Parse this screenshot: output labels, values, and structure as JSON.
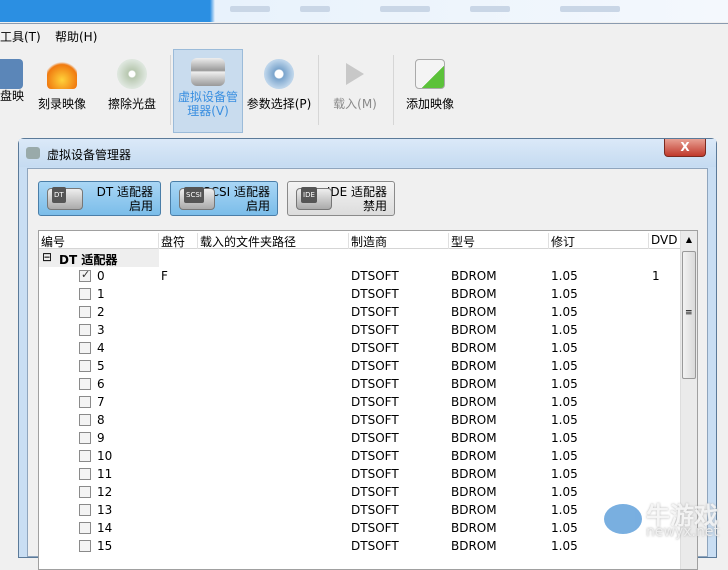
{
  "menu": {
    "tools": "工具(T)",
    "help": "帮助(H)"
  },
  "toolbar": {
    "partial": "盘映",
    "burn": "刻录映像",
    "erase": "擦除光盘",
    "vdm": "虚拟设备管理器(V)",
    "params": "参数选择(P)",
    "mount": "载入(M)",
    "add": "添加映像"
  },
  "dialog": {
    "title": "虚拟设备管理器",
    "close": "X",
    "adapters": [
      {
        "tag": "DT",
        "name": "DT 适配器",
        "state": "启用"
      },
      {
        "tag": "SCSI",
        "name": "SCSI 适配器",
        "state": "启用"
      },
      {
        "tag": "IDE",
        "name": "IDE 适配器",
        "state": "禁用"
      }
    ],
    "columns": [
      "编号",
      "盘符",
      "载入的文件夹路径",
      "制造商",
      "型号",
      "修订",
      "DVD ["
    ],
    "group": "DT 适配器",
    "group_toggle": "⊟",
    "rows": [
      {
        "id": "0",
        "drive": "F",
        "path": "",
        "vendor": "DTSOFT",
        "model": "BDROM",
        "rev": "1.05",
        "dvd": "1",
        "checked": true
      },
      {
        "id": "1",
        "drive": "",
        "path": "",
        "vendor": "DTSOFT",
        "model": "BDROM",
        "rev": "1.05",
        "dvd": "",
        "checked": false
      },
      {
        "id": "2",
        "drive": "",
        "path": "",
        "vendor": "DTSOFT",
        "model": "BDROM",
        "rev": "1.05",
        "dvd": "",
        "checked": false
      },
      {
        "id": "3",
        "drive": "",
        "path": "",
        "vendor": "DTSOFT",
        "model": "BDROM",
        "rev": "1.05",
        "dvd": "",
        "checked": false
      },
      {
        "id": "4",
        "drive": "",
        "path": "",
        "vendor": "DTSOFT",
        "model": "BDROM",
        "rev": "1.05",
        "dvd": "",
        "checked": false
      },
      {
        "id": "5",
        "drive": "",
        "path": "",
        "vendor": "DTSOFT",
        "model": "BDROM",
        "rev": "1.05",
        "dvd": "",
        "checked": false
      },
      {
        "id": "6",
        "drive": "",
        "path": "",
        "vendor": "DTSOFT",
        "model": "BDROM",
        "rev": "1.05",
        "dvd": "",
        "checked": false
      },
      {
        "id": "7",
        "drive": "",
        "path": "",
        "vendor": "DTSOFT",
        "model": "BDROM",
        "rev": "1.05",
        "dvd": "",
        "checked": false
      },
      {
        "id": "8",
        "drive": "",
        "path": "",
        "vendor": "DTSOFT",
        "model": "BDROM",
        "rev": "1.05",
        "dvd": "",
        "checked": false
      },
      {
        "id": "9",
        "drive": "",
        "path": "",
        "vendor": "DTSOFT",
        "model": "BDROM",
        "rev": "1.05",
        "dvd": "",
        "checked": false
      },
      {
        "id": "10",
        "drive": "",
        "path": "",
        "vendor": "DTSOFT",
        "model": "BDROM",
        "rev": "1.05",
        "dvd": "",
        "checked": false
      },
      {
        "id": "11",
        "drive": "",
        "path": "",
        "vendor": "DTSOFT",
        "model": "BDROM",
        "rev": "1.05",
        "dvd": "",
        "checked": false
      },
      {
        "id": "12",
        "drive": "",
        "path": "",
        "vendor": "DTSOFT",
        "model": "BDROM",
        "rev": "1.05",
        "dvd": "",
        "checked": false
      },
      {
        "id": "13",
        "drive": "",
        "path": "",
        "vendor": "DTSOFT",
        "model": "BDROM",
        "rev": "1.05",
        "dvd": "",
        "checked": false
      },
      {
        "id": "14",
        "drive": "",
        "path": "",
        "vendor": "DTSOFT",
        "model": "BDROM",
        "rev": "1.05",
        "dvd": "",
        "checked": false
      },
      {
        "id": "15",
        "drive": "",
        "path": "",
        "vendor": "DTSOFT",
        "model": "BDROM",
        "rev": "1.05",
        "dvd": "",
        "checked": false
      }
    ],
    "scroll_up": "▲",
    "scroll_grip": "≡"
  },
  "watermark": {
    "cn": "牛游戏",
    "en": "newyx.net"
  }
}
